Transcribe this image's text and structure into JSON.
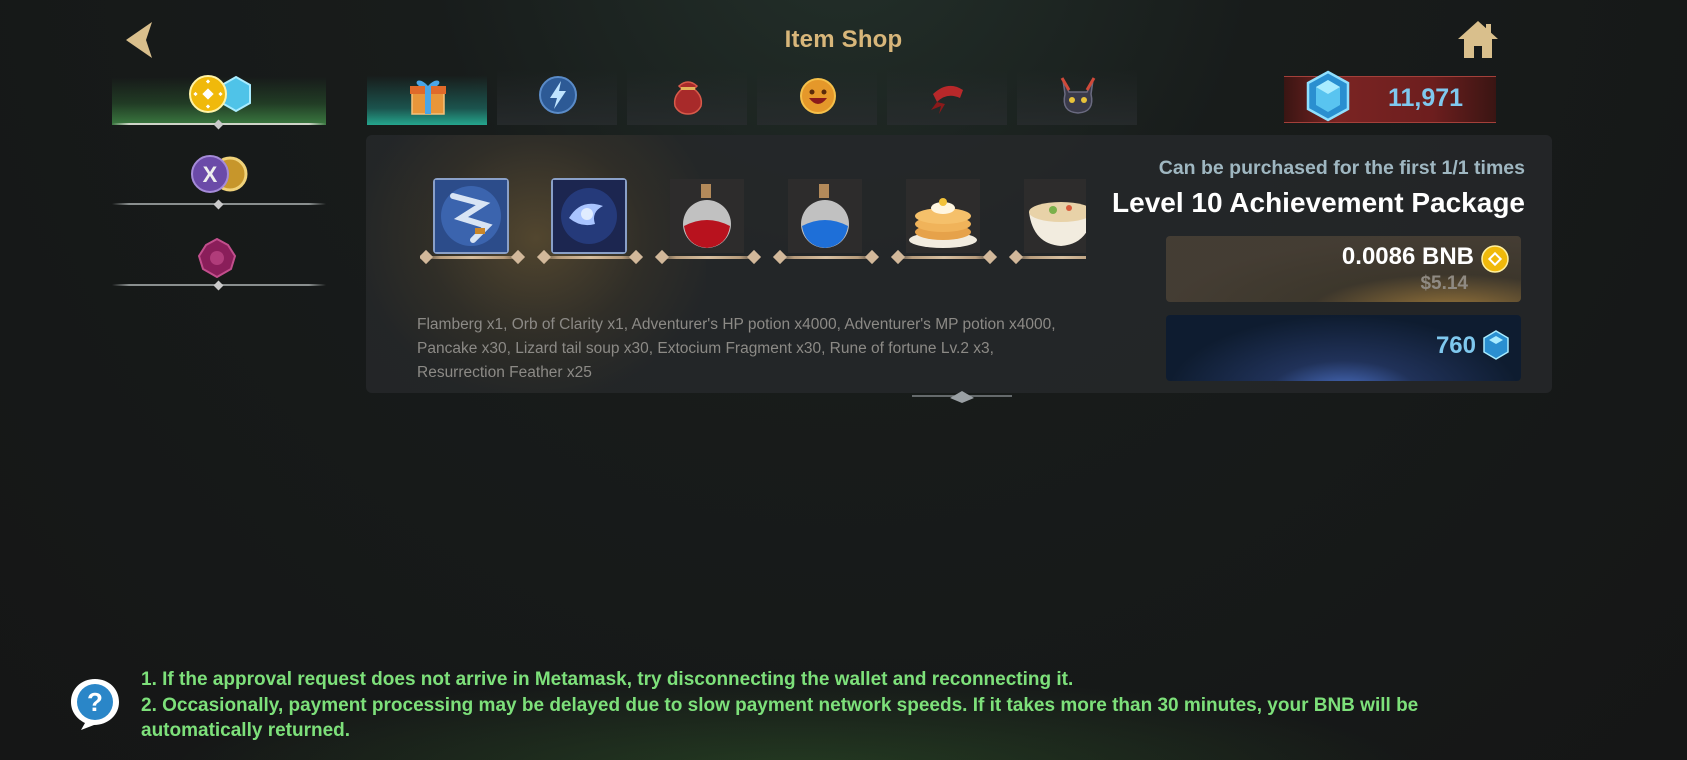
{
  "header": {
    "title": "Item Shop"
  },
  "currency": {
    "gem_count": "11,971"
  },
  "categories": [
    {
      "name": "bnb-gem",
      "active": true
    },
    {
      "name": "x-coin",
      "active": false
    },
    {
      "name": "rune",
      "active": false
    }
  ],
  "sub_tabs": [
    {
      "name": "gift-box",
      "active": true
    },
    {
      "name": "lightning",
      "active": false
    },
    {
      "name": "pouch",
      "active": false
    },
    {
      "name": "emoji",
      "active": false
    },
    {
      "name": "bandana",
      "active": false
    },
    {
      "name": "demon",
      "active": false
    }
  ],
  "package": {
    "purchase_limit": "Can be purchased for the first 1/1 times",
    "name": "Level 10 Achievement Package",
    "items": [
      {
        "icon": "flamberg-icon"
      },
      {
        "icon": "orb-of-clarity-icon"
      },
      {
        "icon": "hp-potion-icon"
      },
      {
        "icon": "mp-potion-icon"
      },
      {
        "icon": "pancake-icon"
      },
      {
        "icon": "lizard-tail-soup-icon"
      }
    ],
    "description": "Flamberg x1, Orb of Clarity x1, Adventurer's HP potion x4000, Adventurer's MP potion x4000, Pancake x30, Lizard tail soup x30, Extocium Fragment x30, Rune of fortune Lv.2 x3, Resurrection Feather x25",
    "price_bnb": "0.0086 BNB",
    "price_usd": "$5.14",
    "price_gem": "760"
  },
  "notice": {
    "line1": "1. If the approval request does not arrive in Metamask,  try disconnecting the wallet and reconnecting it.",
    "line2": "2. Occasionally,  payment processing may be delayed due to slow payment network speeds. If it takes more than 30 minutes,  your BNB will be automatically returned."
  },
  "colors": {
    "title": "#d8b67a",
    "gem_text": "#7fc8ee",
    "notice_text": "#7de07a",
    "active_category": "#58c860",
    "active_subtab": "#28c8aa"
  }
}
